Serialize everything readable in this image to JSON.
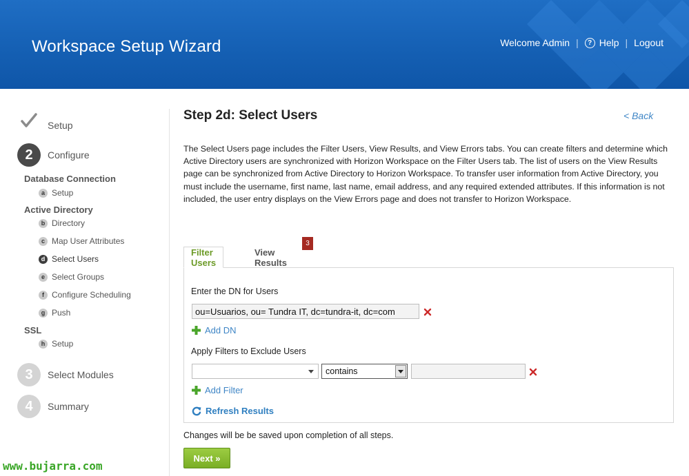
{
  "header": {
    "app_title": "Workspace Setup Wizard",
    "welcome": "Welcome Admin",
    "separator": "|",
    "help": "Help",
    "logout": "Logout"
  },
  "sidebar": {
    "steps": [
      {
        "number": "",
        "label": "Setup",
        "state": "done"
      },
      {
        "number": "2",
        "label": "Configure",
        "state": "active"
      },
      {
        "number": "3",
        "label": "Select Modules",
        "state": "pending"
      },
      {
        "number": "4",
        "label": "Summary",
        "state": "pending"
      }
    ],
    "groups": {
      "database": {
        "title": "Database Connection",
        "items": [
          {
            "badge": "a",
            "label": "Setup"
          }
        ]
      },
      "active_directory": {
        "title": "Active Directory",
        "items": [
          {
            "badge": "b",
            "label": "Directory"
          },
          {
            "badge": "c",
            "label": "Map User Attributes"
          },
          {
            "badge": "d",
            "label": "Select Users",
            "active": true
          },
          {
            "badge": "e",
            "label": "Select Groups"
          },
          {
            "badge": "f",
            "label": "Configure Scheduling"
          },
          {
            "badge": "g",
            "label": "Push"
          }
        ]
      },
      "ssl": {
        "title": "SSL",
        "items": [
          {
            "badge": "h",
            "label": "Setup"
          }
        ]
      }
    }
  },
  "watermark": "www.bujarra.com",
  "main": {
    "title": "Step 2d: Select Users",
    "back": "< Back",
    "description": "The Select Users page includes the Filter Users, View Results, and View Errors tabs. You can create filters and determine which Active Directory users are synchronized with Horizon Workspace on the Filter Users tab. The list of users on the View Results page can be synchronized from Active Directory to Horizon Workspace. To transfer user information from Active Directory, you must include the username, first name, last name, email address, and any required extended attributes. If this information is not included, the user entry displays on the View Errors page and does not transfer to Horizon Workspace.",
    "tabs": [
      {
        "label": "Filter Users",
        "active": true
      },
      {
        "label": "View Results",
        "badge": "3"
      }
    ],
    "dn_label": "Enter the DN for Users",
    "dn_value": "ou=Usuarios, ou= Tundra IT, dc=tundra-it, dc=com",
    "add_dn": "Add DN",
    "filters_label": "Apply Filters to Exclude Users",
    "filter_attribute": "",
    "filter_operator": "contains",
    "filter_value": "",
    "add_filter": "Add Filter",
    "refresh": "Refresh Results",
    "footer_note": "Changes will be be saved upon completion of all steps.",
    "next": "Next »"
  },
  "colors": {
    "header_blue": "#1560b4",
    "accent_green": "#7aae25",
    "link_blue": "#3f86c6",
    "badge_red": "#a52a22",
    "delete_red": "#cc2a2a"
  }
}
